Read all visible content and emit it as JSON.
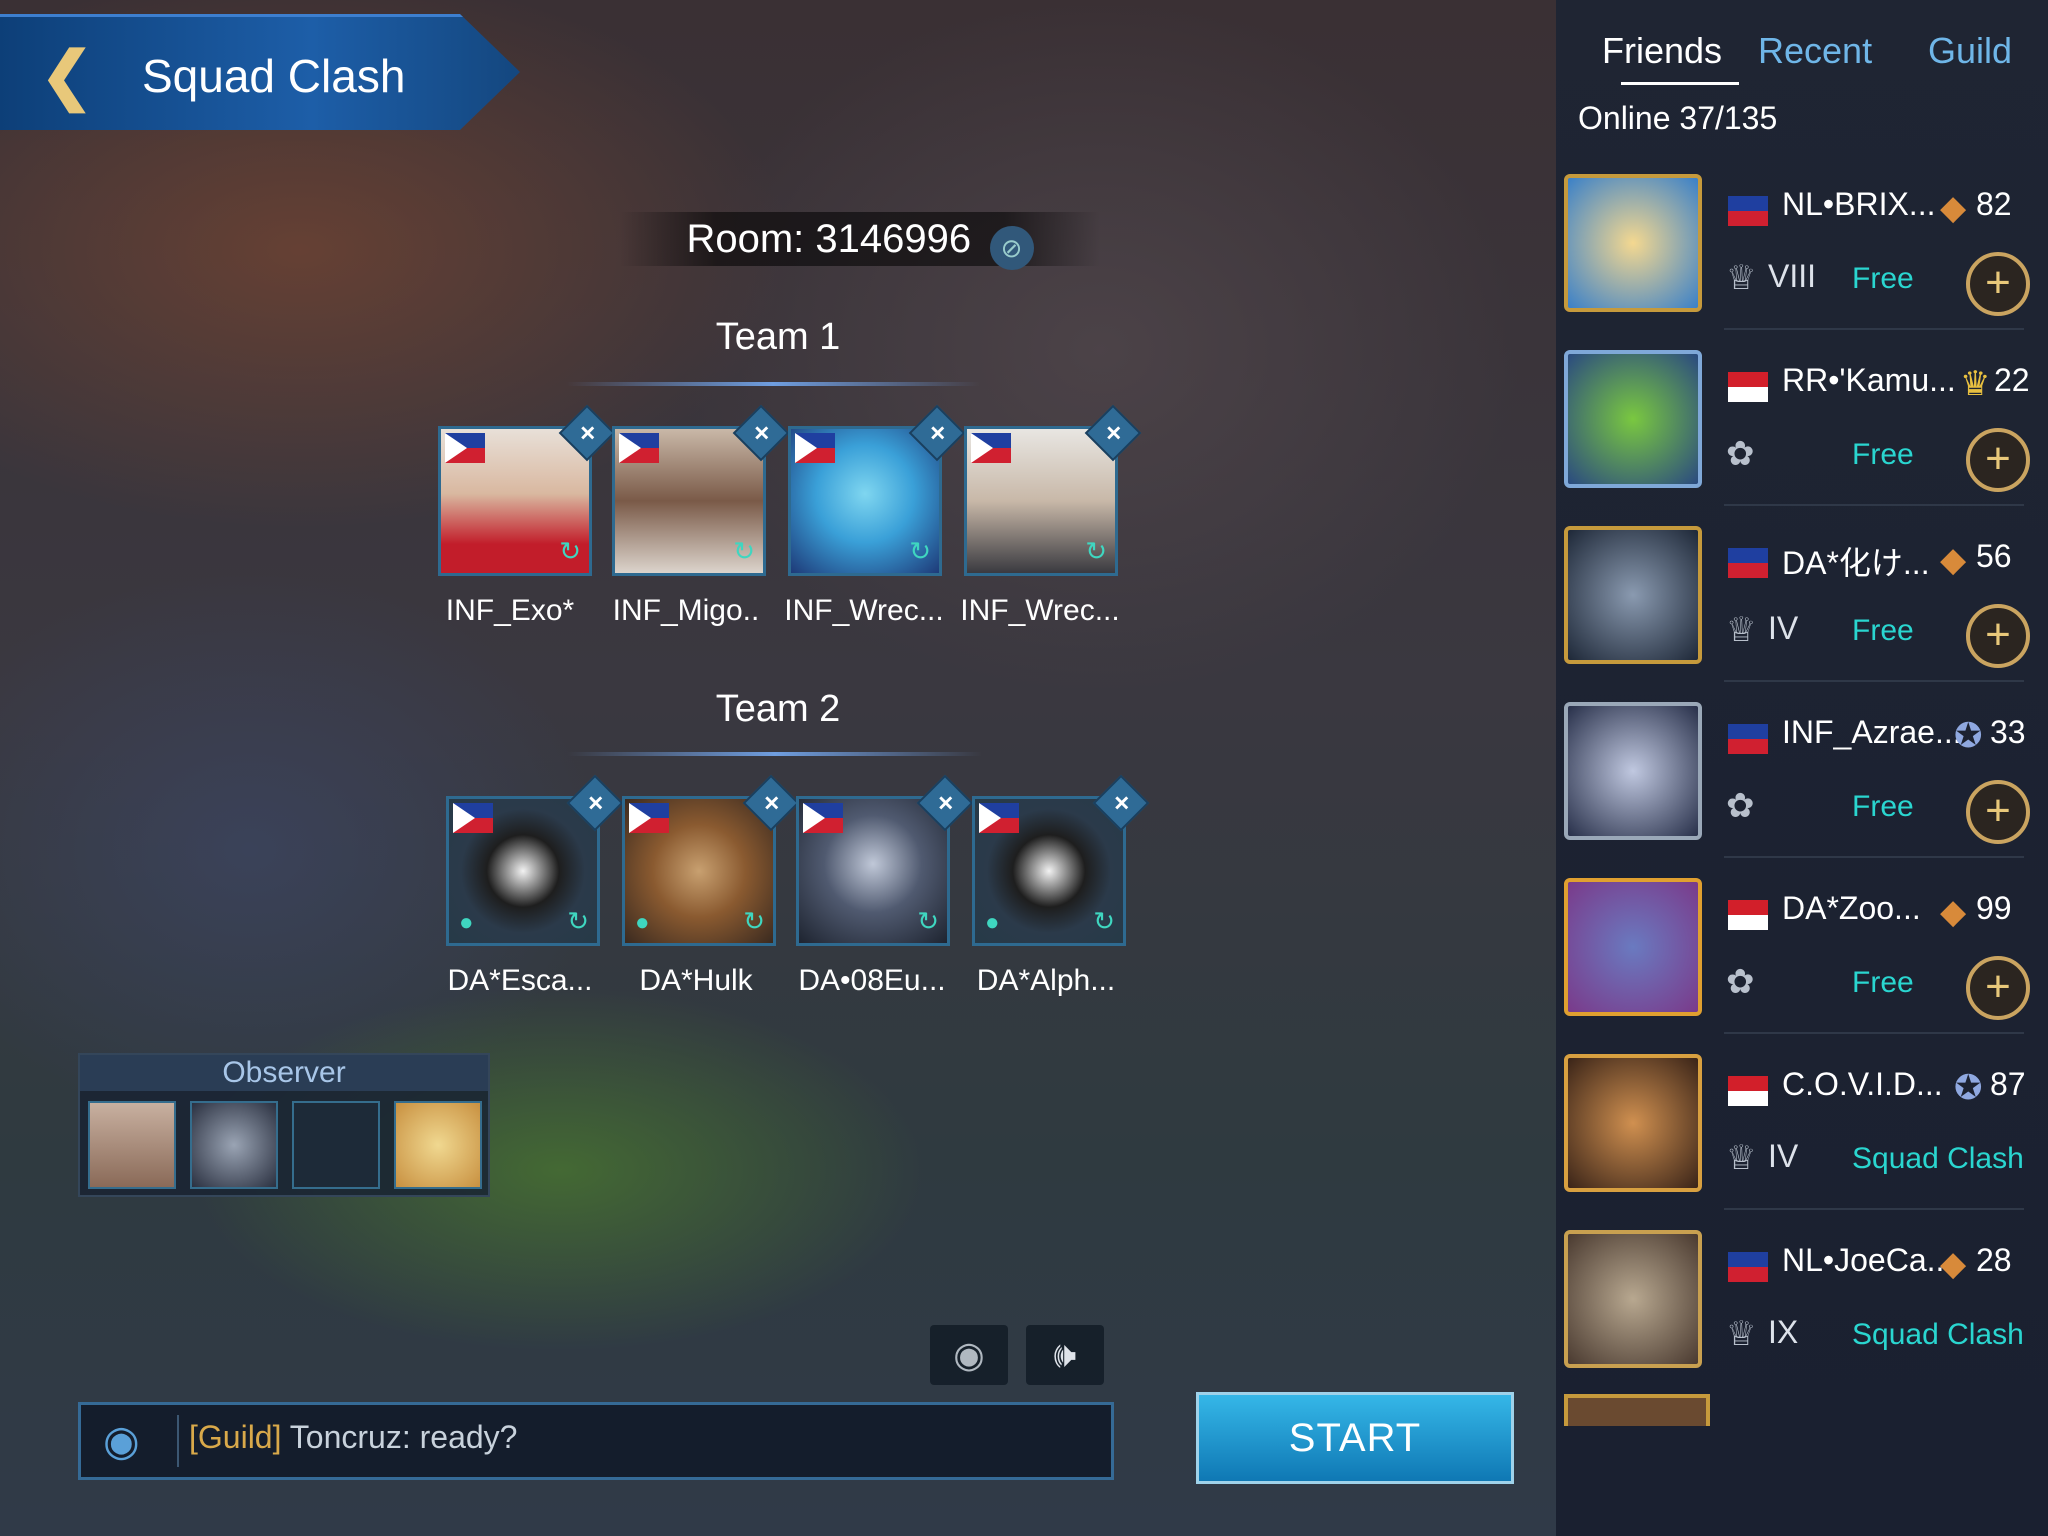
{
  "header": {
    "back_icon": "chevron-left-icon",
    "title": "Squad Clash"
  },
  "room": {
    "label": "Room: 3146996",
    "eye_icon": "eye-hidden-icon"
  },
  "teams": [
    {
      "title": "Team 1",
      "players": [
        {
          "name": "INF_Exo*"
        },
        {
          "name": "INF_Migo.."
        },
        {
          "name": "INF_Wrec..."
        },
        {
          "name": "INF_Wrec..."
        }
      ]
    },
    {
      "title": "Team 2",
      "players": [
        {
          "name": "DA*Esca..."
        },
        {
          "name": "DA*Hulk"
        },
        {
          "name": "DA•08Eu..."
        },
        {
          "name": "DA*Alph..."
        }
      ]
    }
  ],
  "observer": {
    "label": "Observer"
  },
  "chat": {
    "channel": "[Guild]",
    "message": " Toncruz: ready?"
  },
  "start_label": "START",
  "panel": {
    "tabs": [
      "Friends",
      "Recent",
      "Guild"
    ],
    "active_tab": "Friends",
    "online": "Online 37/135",
    "friends": [
      {
        "name": "NL•BRIX...",
        "level": "82",
        "tier": "VIII",
        "status": "Free",
        "flag": "ph"
      },
      {
        "name": "RR•'Kamu...",
        "level": "22",
        "tier": "",
        "status": "Free",
        "flag": "id"
      },
      {
        "name": "DA*化け...",
        "level": "56",
        "tier": "IV",
        "status": "Free",
        "flag": "ph"
      },
      {
        "name": "INF_Azrae...",
        "level": "33",
        "tier": "",
        "status": "Free",
        "flag": "ph"
      },
      {
        "name": "DA*Zoo...",
        "level": "99",
        "tier": "",
        "status": "Free",
        "flag": "sg"
      },
      {
        "name": "C.O.V.I.D...",
        "level": "87",
        "tier": "IV",
        "status": "Squad Clash",
        "flag": "id"
      },
      {
        "name": "NL•JoeCa...",
        "level": "28",
        "tier": "IX",
        "status": "Squad Clash",
        "flag": "ph"
      }
    ]
  }
}
